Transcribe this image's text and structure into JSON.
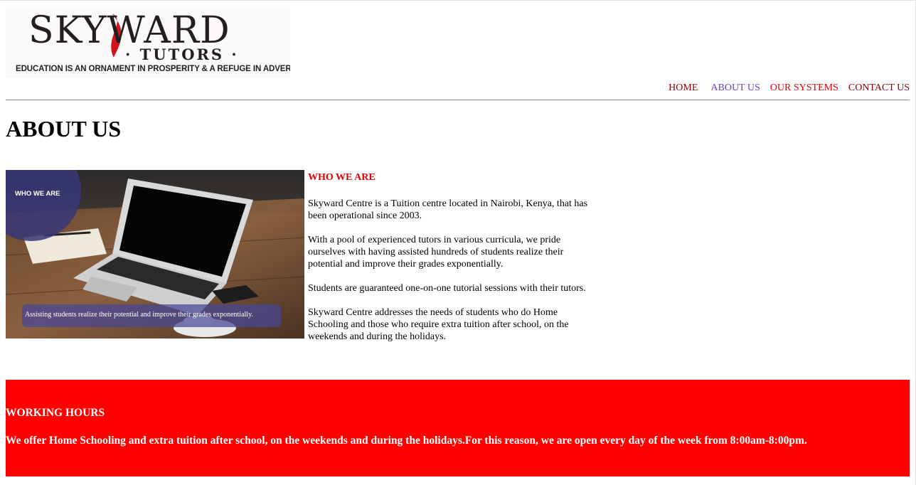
{
  "brand": {
    "name": "SKYWARD",
    "sub": "· TUTORS ·",
    "motto": "EDUCATION IS AN ORNAMENT IN PROSPERITY & A REFUGE IN ADVERSITY"
  },
  "nav": {
    "items": [
      {
        "label": "HOME"
      },
      {
        "label": "ABOUT US"
      },
      {
        "label": "OUR SYSTEMS"
      },
      {
        "label": "CONTACT US"
      }
    ],
    "active": "ABOUT US"
  },
  "page": {
    "title": "ABOUT US"
  },
  "photo": {
    "badge": "WHO WE ARE",
    "caption": "Assisting  students realize their potential and improve their grades exponentially."
  },
  "about": {
    "heading": "WHO WE ARE",
    "paragraphs": [
      "Skyward Centre is a Tuition centre located in Nairobi, Kenya, that has been operational since 2003.",
      "With a pool of experienced tutors in various curricula, we pride ourselves with having assisted hundreds of students realize their potential and improve their grades exponentially.",
      "Students are guaranteed one-on-one tutorial sessions with their tutors.",
      "Skyward Centre addresses the needs of students who do Home Schooling and those who require extra tuition after school, on the weekends and during the holidays."
    ]
  },
  "hours": {
    "heading": "WORKING HOURS",
    "text": "We offer Home Schooling and extra tuition after school, on the weekends and during the holidays.For this reason, we are open every day of the week from 8:00am-8:00pm."
  },
  "colors": {
    "accent": "#ff0000",
    "nav_link": "#8b0000",
    "nav_active": "#6f3fc7"
  }
}
